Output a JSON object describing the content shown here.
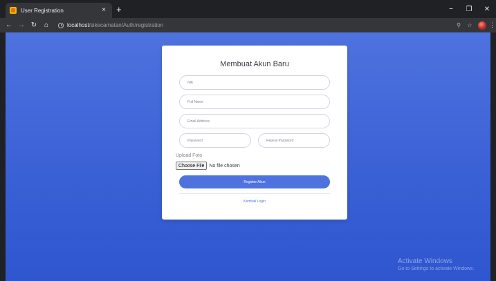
{
  "browser": {
    "tab": {
      "title": "User Registration",
      "close": "×"
    },
    "new_tab": "+",
    "window_controls": {
      "minimize": "−",
      "restore": "❐",
      "close": "✕"
    },
    "url": {
      "host": "localhost",
      "path": "/sikecamatan/Auth/registration"
    },
    "nav": {
      "back": "←",
      "forward": "→",
      "reload": "↻",
      "home": "⌂"
    },
    "tools": {
      "zoom": "⚲",
      "bookmark": "☆",
      "menu": "⋮"
    }
  },
  "form": {
    "title": "Membuat Akun Baru",
    "placeholders": {
      "nik": "NIK",
      "full_name": "Full Name",
      "email": "Email Address",
      "password": "Password",
      "repeat_password": "Repeat Password"
    },
    "upload_label": "Upload Foto",
    "file_button": "Choose File",
    "file_status": "No file chosen",
    "submit_label": "Register Akun",
    "back_link": "Kembali Login"
  },
  "watermark": {
    "title": "Activate Windows",
    "subtitle": "Go to Settings to activate Windows."
  },
  "colors": {
    "accent": "#4e73df",
    "page_bg": "#3b61d6",
    "chrome_dark": "#202124",
    "toolbar": "#35363a"
  }
}
